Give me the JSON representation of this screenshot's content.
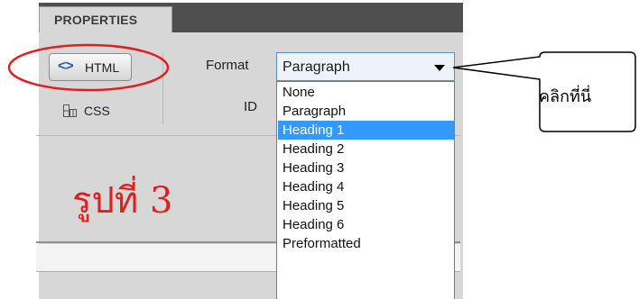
{
  "panel": {
    "tab_label": "PROPERTIES",
    "html_button": {
      "icon": "<>",
      "icon_name": "code-brackets-icon",
      "label": "HTML"
    },
    "css_button": {
      "icon_name": "css-grid-icon",
      "label": "CSS"
    },
    "format_label": "Format",
    "id_label": "ID",
    "format_select": {
      "value": "Paragraph"
    },
    "dropdown_options": [
      "None",
      "Paragraph",
      "Heading 1",
      "Heading 2",
      "Heading 3",
      "Heading 4",
      "Heading 5",
      "Heading 6",
      "Preformatted"
    ],
    "highlighted_option": "Heading 1"
  },
  "annotations": {
    "caption": "รูปที่ 3",
    "callout_text": "คลิกที่นี่",
    "circle_color": "#e02020",
    "caption_color": "#e02020",
    "selection_color": "#3399ff"
  }
}
